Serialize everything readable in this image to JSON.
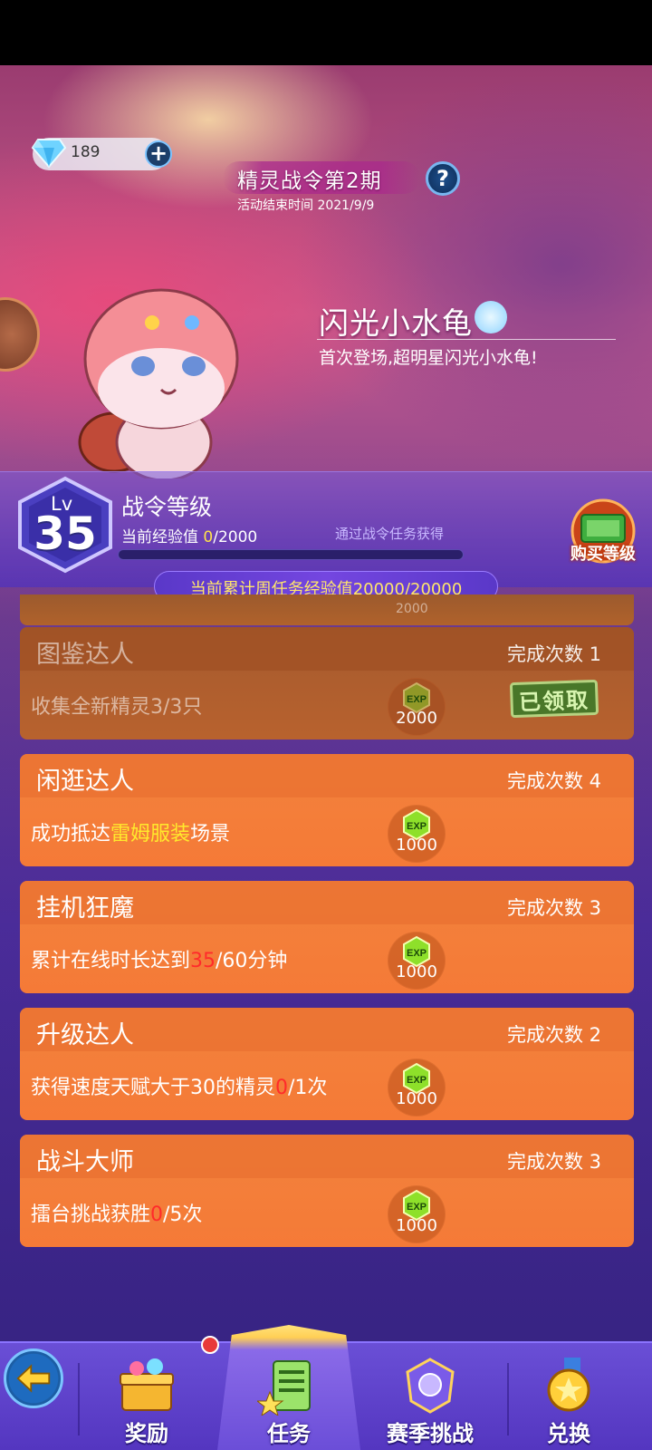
{
  "header": {
    "diamonds": "189",
    "title": "精灵战令第2期",
    "end_time": "活动结束时间 2021/9/9"
  },
  "featured_pet": {
    "name": "闪光小水龟",
    "description": "首次登场,超明星闪光小水龟!"
  },
  "battle_pass": {
    "lv_label": "Lv",
    "level": "35",
    "title": "战令等级",
    "exp_label": "当前经验值",
    "exp_current": "0",
    "exp_total": "/2000",
    "exp_progress": 0,
    "exp_hint": "通过战令任务获得",
    "buy_level_label": "购买等级",
    "weekly_exp": "当前累计周任务经验值20000/20000"
  },
  "partial_card": {
    "exp": "2000"
  },
  "tasks": [
    {
      "name": "图鉴达人",
      "count": "完成次数 1",
      "desc_prefix": "收集全新精灵3/3只",
      "exp": "2000",
      "claimed_label": "已领取"
    },
    {
      "name": "闲逛达人",
      "count": "完成次数 4",
      "desc_prefix": "成功抵达",
      "desc_highlight": "雷姆服装",
      "desc_suffix": "场景",
      "exp": "1000"
    },
    {
      "name": "挂机狂魔",
      "count": "完成次数 3",
      "desc_prefix": "累计在线时长达到",
      "desc_highlight": "35",
      "desc_suffix": "/60分钟",
      "exp": "1000"
    },
    {
      "name": "升级达人",
      "count": "完成次数 2",
      "desc_prefix": "获得速度天赋大于30的精灵",
      "desc_highlight": "0",
      "desc_suffix": "/1次",
      "exp": "1000"
    },
    {
      "name": "战斗大师",
      "count": "完成次数 3",
      "desc_prefix": "擂台挑战获胜",
      "desc_highlight": "0",
      "desc_suffix": "/5次",
      "exp": "1000"
    }
  ],
  "exp_icon_label": "EXP",
  "nav": {
    "back_icon": "back-arrow-icon",
    "items": [
      {
        "label": "奖励",
        "icon": "gift-chest-icon"
      },
      {
        "label": "任务",
        "icon": "task-clipboard-icon"
      },
      {
        "label": "赛季挑战",
        "icon": "season-crest-icon"
      },
      {
        "label": "兑换",
        "icon": "exchange-medal-icon"
      }
    ],
    "active_index": 1
  },
  "colors": {
    "card_orange": "#f57a37",
    "card_claimed": "#b0622c",
    "highlight_red": "#ff2b2b",
    "highlight_yellow": "#ffe92c",
    "nav_purple": "#5436c0"
  }
}
